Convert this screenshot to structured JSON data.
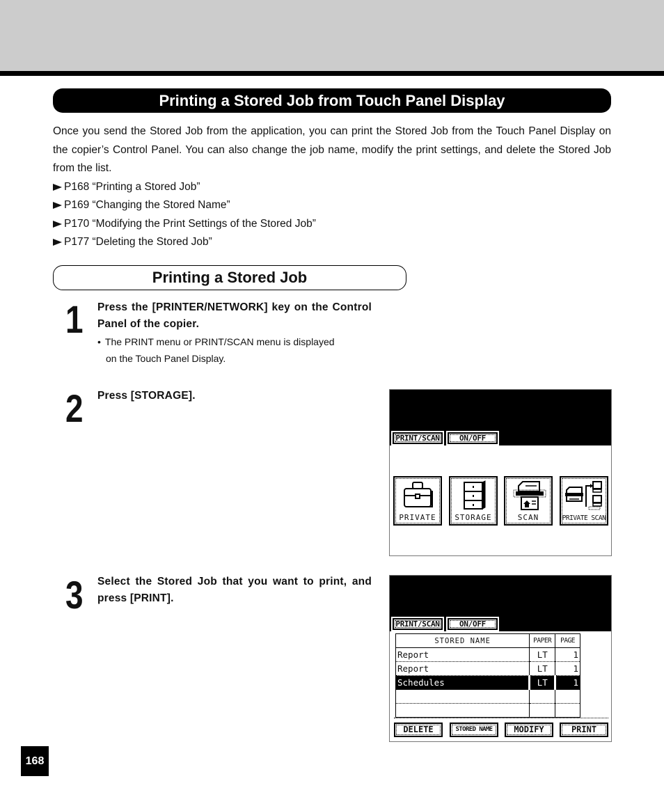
{
  "main_title": "Printing a Stored Job from Touch Panel Display",
  "intro": {
    "paragraph": "Once you send the Stored Job from the application, you can print the Stored Job from the Touch Panel Display on the copier’s Control Panel.  You can also change the job name, modify the print settings, and delete the Stored Job from the list.",
    "references": [
      {
        "icon": "arrow-right-icon",
        "text": "P168 “Printing a Stored Job”"
      },
      {
        "icon": "arrow-right-icon",
        "text": "P169 “Changing the Stored Name”"
      },
      {
        "icon": "arrow-right-icon",
        "text": "P170 “Modifying the Print Settings of the Stored Job”"
      },
      {
        "icon": "arrow-right-icon",
        "text": "P177 “Deleting the Stored Job”"
      }
    ]
  },
  "section_title": "Printing a Stored Job",
  "steps": [
    {
      "number": "1",
      "text": "Press the [PRINTER/NETWORK] key on the Control Panel of the copier.",
      "note_bullet": "•",
      "note_line1": "The PRINT menu or PRINT/SCAN menu is displayed",
      "note_line2": "on the Touch Panel Display."
    },
    {
      "number": "2",
      "text": "Press [STORAGE]."
    },
    {
      "number": "3",
      "text": "Select the Stored Job that you want to print, and press [PRINT]."
    }
  ],
  "panel_menu": {
    "tabs": [
      "PRINT/SCAN",
      "ON/OFF"
    ],
    "active_tab": "PRINT/SCAN",
    "buttons": [
      {
        "label": "PRIVATE",
        "icon": "briefcase-icon"
      },
      {
        "label": "STORAGE",
        "icon": "cabinet-icon"
      },
      {
        "label": "SCAN",
        "icon": "scanner-icon"
      },
      {
        "label": "PRIVATE SCAN",
        "icon": "network-scan-icon"
      }
    ]
  },
  "panel_list": {
    "tabs": [
      "PRINT/SCAN",
      "ON/OFF"
    ],
    "active_tab": "PRINT/SCAN",
    "columns": [
      "STORED NAME",
      "PAPER",
      "PAGE"
    ],
    "rows": [
      {
        "name": "Report",
        "paper": "LT",
        "page": "1",
        "selected": false
      },
      {
        "name": "Report",
        "paper": "LT",
        "page": "1",
        "selected": false
      },
      {
        "name": "Schedules",
        "paper": "LT",
        "page": "1",
        "selected": true
      },
      {
        "name": "",
        "paper": "",
        "page": "",
        "selected": false
      },
      {
        "name": "",
        "paper": "",
        "page": "",
        "selected": false
      }
    ],
    "actions": [
      "DELETE",
      "STORED NAME",
      "MODIFY",
      "PRINT"
    ]
  },
  "page_number": "168"
}
